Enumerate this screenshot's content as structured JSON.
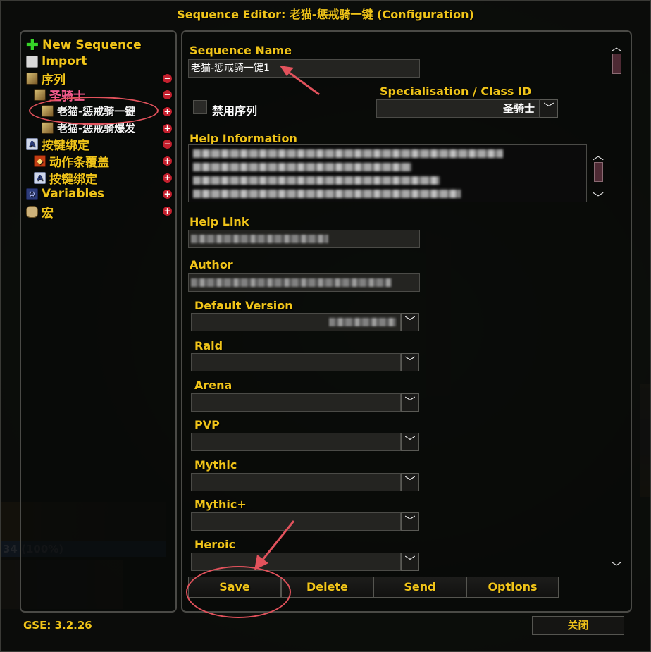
{
  "window": {
    "title": "Sequence Editor: 老猫-惩戒骑一键 (Configuration)"
  },
  "tree": {
    "new_sequence": "New Sequence",
    "import": "Import",
    "sequences": "序列",
    "paladin": "圣骑士",
    "seq1": "老猫-惩戒骑一键",
    "seq2": "老猫-惩戒骑爆发",
    "keybinds": "按键绑定",
    "action_override": "动作条覆盖",
    "keybinds_sub": "按键绑定",
    "variables": "Variables",
    "macros": "宏"
  },
  "form": {
    "sequence_name_label": "Sequence Name",
    "sequence_name_value": "老猫-惩戒骑一键1",
    "spec_label": "Specialisation / Class ID",
    "spec_value": "圣骑士",
    "disable_label": "禁用序列",
    "help_info_label": "Help Information",
    "help_link_label": "Help Link",
    "author_label": "Author",
    "default_version_label": "Default Version",
    "raid_label": "Raid",
    "arena_label": "Arena",
    "pvp_label": "PVP",
    "mythic_label": "Mythic",
    "mythic_plus_label": "Mythic+",
    "heroic_label": "Heroic"
  },
  "buttons": {
    "save": "Save",
    "delete": "Delete",
    "send": "Send",
    "options": "Options",
    "close": "关闭"
  },
  "footer": {
    "version": "GSE: 3.2.26"
  },
  "bg_ui": {
    "health_text": "34 (100%)"
  },
  "colors": {
    "accent": "#f0c419",
    "annotation": "#e2525c",
    "sequence_pink": "#f05a8c"
  }
}
